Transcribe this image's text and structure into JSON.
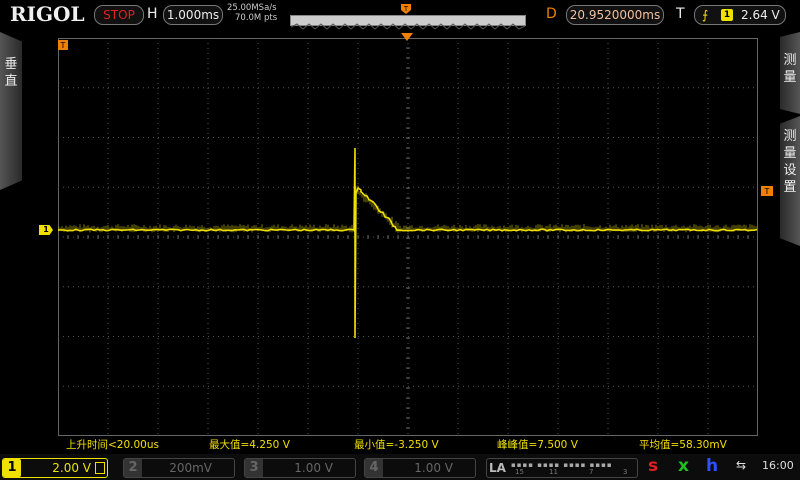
{
  "header": {
    "logo": "RIGOL",
    "run_status": "STOP",
    "horizontal_label": "H",
    "timebase": "1.000ms",
    "sample_rate": "25.00MSa/s",
    "memory_depth": "70.0M pts",
    "delay_label": "D",
    "delay_value": "20.9520000ms",
    "trigger_label": "T",
    "trigger_source": "1",
    "trigger_level": "2.64 V",
    "trigger_edge_icon": "rising-edge-icon"
  },
  "left_tab": {
    "label": "垂直"
  },
  "right_tabs": [
    {
      "label": "测量"
    },
    {
      "label": "测量设置"
    }
  ],
  "markers": {
    "trigger_top": "T",
    "trigger_left": "T",
    "trigger_right": "T",
    "channel1": "1"
  },
  "measurements": [
    {
      "text": "上升时间<20.00us"
    },
    {
      "text": "最大值=4.250 V"
    },
    {
      "text": "最小值=-3.250 V"
    },
    {
      "text": "峰峰值=7.500 V"
    },
    {
      "text": "平均值=58.30mV"
    }
  ],
  "channels": [
    {
      "num": "1",
      "scale": "2.00 V",
      "active": true
    },
    {
      "num": "2",
      "scale": "200mV",
      "active": false
    },
    {
      "num": "3",
      "scale": "1.00 V",
      "active": false
    },
    {
      "num": "4",
      "scale": "1.00 V",
      "active": false
    }
  ],
  "logic_analyzer": {
    "label": "LA",
    "nums": [
      "15",
      "11",
      "7",
      "3"
    ]
  },
  "status_letters": {
    "s": "s",
    "x": "x",
    "h": "h"
  },
  "clock": "16:00",
  "colors": {
    "channel1": "#f0e000",
    "stop": "#e02020",
    "delay": "#f08000"
  }
}
